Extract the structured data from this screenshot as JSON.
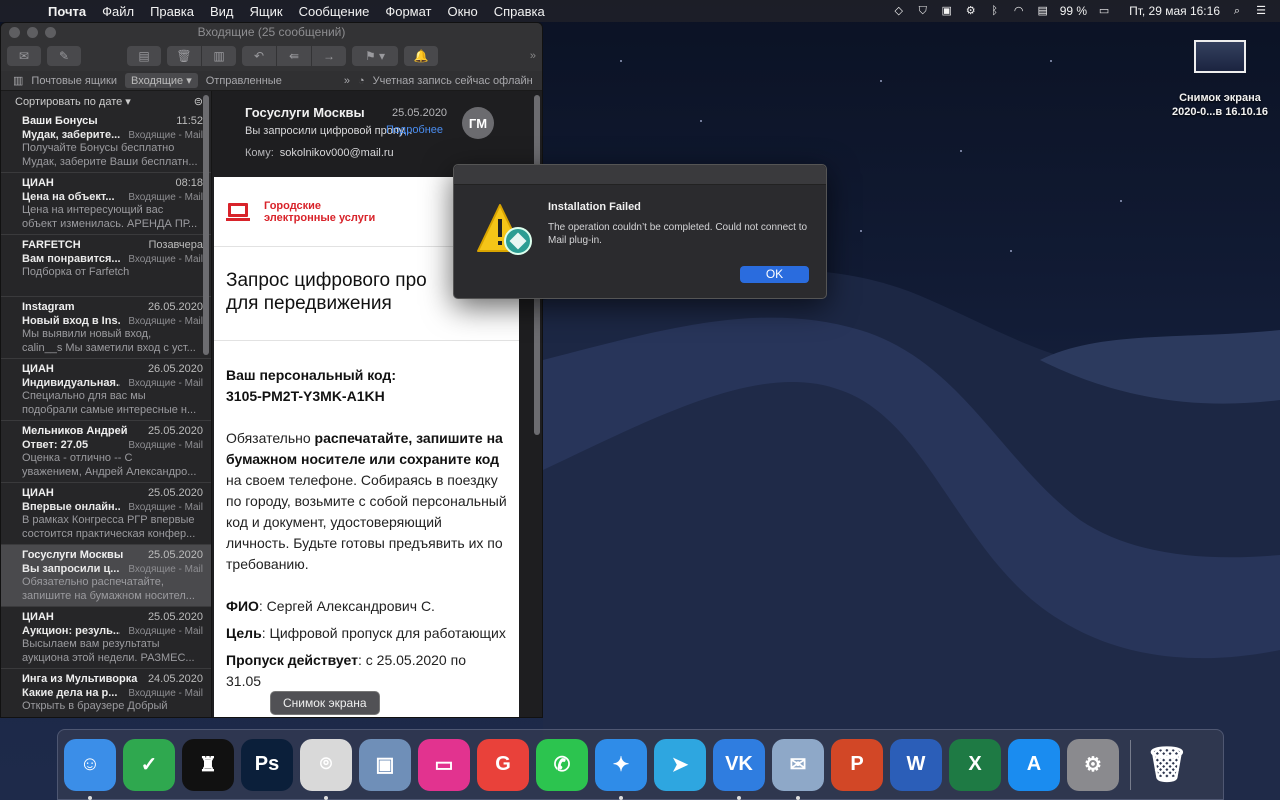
{
  "menubar": {
    "app_name": "Почта",
    "menus": [
      "Файл",
      "Правка",
      "Вид",
      "Ящик",
      "Сообщение",
      "Формат",
      "Окно",
      "Справка"
    ],
    "battery": "99 %",
    "datetime": "Пт, 29 мая  16:16"
  },
  "mail": {
    "window_title": "Входящие (25 сообщений)",
    "favorites": {
      "mailboxes": "Почтовые ящики",
      "inbox": "Входящие",
      "sent": "Отправленные",
      "account_status": "Учетная запись сейчас офлайн"
    },
    "sort_label": "Сортировать по дате",
    "messages": [
      {
        "sender": "Ваши Бонусы",
        "date": "11:52",
        "subject": "Мудак, заберите...",
        "mailbox": "Входящие - Mail",
        "preview1": "Получайте Бонусы бесплатно",
        "preview2": "Мудак, заберите Ваши бесплатн..."
      },
      {
        "sender": "ЦИАН",
        "date": "08:18",
        "subject": "Цена на объект...",
        "mailbox": "Входящие - Mail",
        "preview1": "Цена на интересующий вас",
        "preview2": "объект изменилась. АРЕНДА ПР..."
      },
      {
        "sender": "FARFETCH",
        "date": "Позавчера",
        "subject": "Вам понравится...",
        "mailbox": "Входящие - Mail",
        "preview1": "Подборка от Farfetch",
        "preview2": ""
      },
      {
        "sender": "Instagram",
        "date": "26.05.2020",
        "subject": "Новый вход в Ins...",
        "mailbox": "Входящие - Mail",
        "preview1": "Мы выявили новый вход,",
        "preview2": "calin__s Мы заметили вход с уст..."
      },
      {
        "sender": "ЦИАН",
        "date": "26.05.2020",
        "subject": "Индивидуальная...",
        "mailbox": "Входящие - Mail",
        "preview1": "Специально для вас мы",
        "preview2": "подобрали самые интересные н..."
      },
      {
        "sender": "Мельников Андрей",
        "date": "25.05.2020",
        "subject": "Ответ: 27.05",
        "mailbox": "Входящие - Mail",
        "preview1": "Оценка - отлично       --  С",
        "preview2": "уважением, Андрей Александро..."
      },
      {
        "sender": "ЦИАН",
        "date": "25.05.2020",
        "subject": "Впервые онлайн...",
        "mailbox": "Входящие - Mail",
        "preview1": "В рамках Конгресса РГР впервые",
        "preview2": "состоится практическая конфер..."
      },
      {
        "sender": "Госуслуги Москвы",
        "date": "25.05.2020",
        "subject": "Вы запросили ц...",
        "mailbox": "Входящие - Mail",
        "preview1": "Обязательно распечатайте,",
        "preview2": "запишите на бумажном носител..."
      },
      {
        "sender": "ЦИАН",
        "date": "25.05.2020",
        "subject": "Аукцион: резуль...",
        "mailbox": "Входящие - Mail",
        "preview1": "Высылаем вам результаты",
        "preview2": "аукциона этой недели. РАЗМЕС..."
      },
      {
        "sender": "Инга из Мультиворка",
        "date": "24.05.2020",
        "subject": "Какие дела на р...",
        "mailbox": "Входящие - Mail",
        "preview1": "Открыть в браузере Добрый",
        "preview2": ""
      }
    ],
    "viewer": {
      "from": "Госуслуги Москвы",
      "date": "25.05.2020",
      "subject": "Вы запросили цифровой пропу...",
      "more": "Подробнее",
      "to_label": "Кому:",
      "to": "sokolnikov000@mail.ru",
      "avatar": "ГМ"
    },
    "email": {
      "logo_line1": "Городские",
      "logo_line2": "электронные услуги",
      "title_line1": "Запрос цифрового про",
      "title_line2": "для передвижения",
      "code_label": "Ваш персональный код:",
      "code": "3105-PM2T-Y3MK-A1KH",
      "instr_prefix": "Обязательно ",
      "instr_bold": "распечатайте, запишите на бумажном носителе или сохраните код",
      "instr_rest": " на своем телефоне. Собираясь в поездку по городу, возьмите с собой персональный код и документ, удостоверяющий личность. Будьте готовы предъявить их по требованию.",
      "fio_label": "ФИО",
      "fio": ": Сергей Александрович С.",
      "goal_label": "Цель",
      "goal": ": Цифровой пропуск для работающих",
      "valid_label": "Пропуск действует",
      "valid": ": с 25.05.2020 по",
      "valid_end": "31.05"
    }
  },
  "tooltip": "Снимок экрана",
  "alert": {
    "title": "Installation Failed",
    "message": "The operation couldn’t be completed. Could not connect to Mail plug-in.",
    "ok": "OK"
  },
  "desktop_file": {
    "line1": "Снимок экрана",
    "line2": "2020-0...в 16.10.16"
  },
  "dock": [
    {
      "name": "finder-icon",
      "bg": "#3b8ee8",
      "glyph": "☺",
      "dot": true
    },
    {
      "name": "adguard-icon",
      "bg": "#2fa84f",
      "glyph": "✓",
      "dot": false
    },
    {
      "name": "chess-icon",
      "bg": "#111111",
      "glyph": "♜",
      "dot": false
    },
    {
      "name": "photoshop-icon",
      "bg": "#0b1f3a",
      "glyph": "Ps",
      "dot": false
    },
    {
      "name": "screenshot-app-icon",
      "bg": "#d9d9d9",
      "glyph": "⌾",
      "dot": true
    },
    {
      "name": "preview-icon",
      "bg": "#6f8fb8",
      "glyph": "▣",
      "dot": false
    },
    {
      "name": "cleanmymac-icon",
      "bg": "#e2338f",
      "glyph": "▭",
      "dot": false
    },
    {
      "name": "grammarly-icon",
      "bg": "#e9413a",
      "glyph": "G",
      "dot": false
    },
    {
      "name": "whatsapp-icon",
      "bg": "#2cc44f",
      "glyph": "✆",
      "dot": false
    },
    {
      "name": "safari-icon",
      "bg": "#2f8ce8",
      "glyph": "✦",
      "dot": true
    },
    {
      "name": "telegram-icon",
      "bg": "#2ea6e0",
      "glyph": "➤",
      "dot": false
    },
    {
      "name": "vk-icon",
      "bg": "#2f7de0",
      "glyph": "VK",
      "dot": true
    },
    {
      "name": "mail-icon",
      "bg": "#8ea8c8",
      "glyph": "✉",
      "dot": true
    },
    {
      "name": "powerpoint-icon",
      "bg": "#d24726",
      "glyph": "P",
      "dot": false
    },
    {
      "name": "word-icon",
      "bg": "#2b5eb8",
      "glyph": "W",
      "dot": false
    },
    {
      "name": "excel-icon",
      "bg": "#1e7a44",
      "glyph": "X",
      "dot": false
    },
    {
      "name": "app-store-icon",
      "bg": "#1a8cf0",
      "glyph": "A",
      "dot": false
    },
    {
      "name": "system-preferences-icon",
      "bg": "#8a8a8e",
      "glyph": "⚙",
      "dot": false
    }
  ],
  "trash": {
    "name": "trash-icon",
    "glyph": "🗑"
  }
}
